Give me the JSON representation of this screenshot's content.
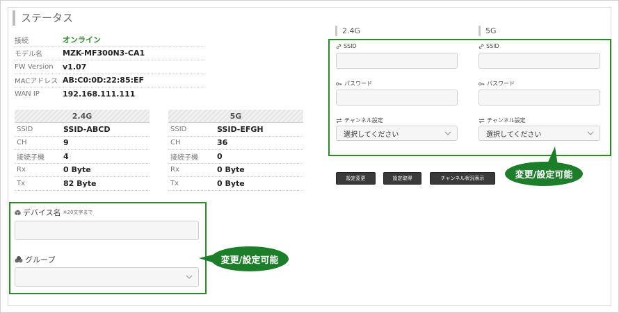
{
  "page": {
    "title": "ステータス"
  },
  "status": {
    "rows": [
      {
        "label": "接続",
        "value": "オンライン"
      },
      {
        "label": "モデル名",
        "value": "MZK-MF300N3-CA1"
      },
      {
        "label": "FW Version",
        "value": "v1.07"
      },
      {
        "label": "MACアドレス",
        "value": "AB:C0:0D:22:85:EF"
      },
      {
        "label": "WAN IP",
        "value": "192.168.111.111"
      }
    ]
  },
  "band24": {
    "title": "2.4G",
    "rows": [
      {
        "label": "SSID",
        "value": "SSID-ABCD"
      },
      {
        "label": "CH",
        "value": "9"
      },
      {
        "label": "接続子機",
        "value": "4"
      },
      {
        "label": "Rx",
        "value": "0 Byte"
      },
      {
        "label": "Tx",
        "value": "82 Byte"
      }
    ]
  },
  "band5": {
    "title": "5G",
    "rows": [
      {
        "label": "SSID",
        "value": "SSID-EFGH"
      },
      {
        "label": "CH",
        "value": "36"
      },
      {
        "label": "接続子機",
        "value": "0"
      },
      {
        "label": "Rx",
        "value": "0 Byte"
      },
      {
        "label": "Tx",
        "value": "0 Byte"
      }
    ]
  },
  "device": {
    "name_label": "デバイス名",
    "name_note": "※20文字まで",
    "name_value": "",
    "group_label": "グループ",
    "group_value": ""
  },
  "wifi": {
    "band24_title": "2.4G",
    "band5_title": "5G",
    "ssid_label": "SSID",
    "password_label": "パスワード",
    "channel_label": "チャンネル設定",
    "channel_select_24": "選択してください",
    "channel_select_5": "選択してください"
  },
  "buttons": {
    "apply": "設定変更",
    "fetch": "設定取得",
    "channel_status": "チャンネル状況表示"
  },
  "callouts": {
    "wifi": "変更/設定可能",
    "device": "変更/設定可能"
  },
  "colors": {
    "accent_green": "#2a8a2a",
    "callout_green": "#1d7e2a",
    "button": "#3a3a3a"
  }
}
